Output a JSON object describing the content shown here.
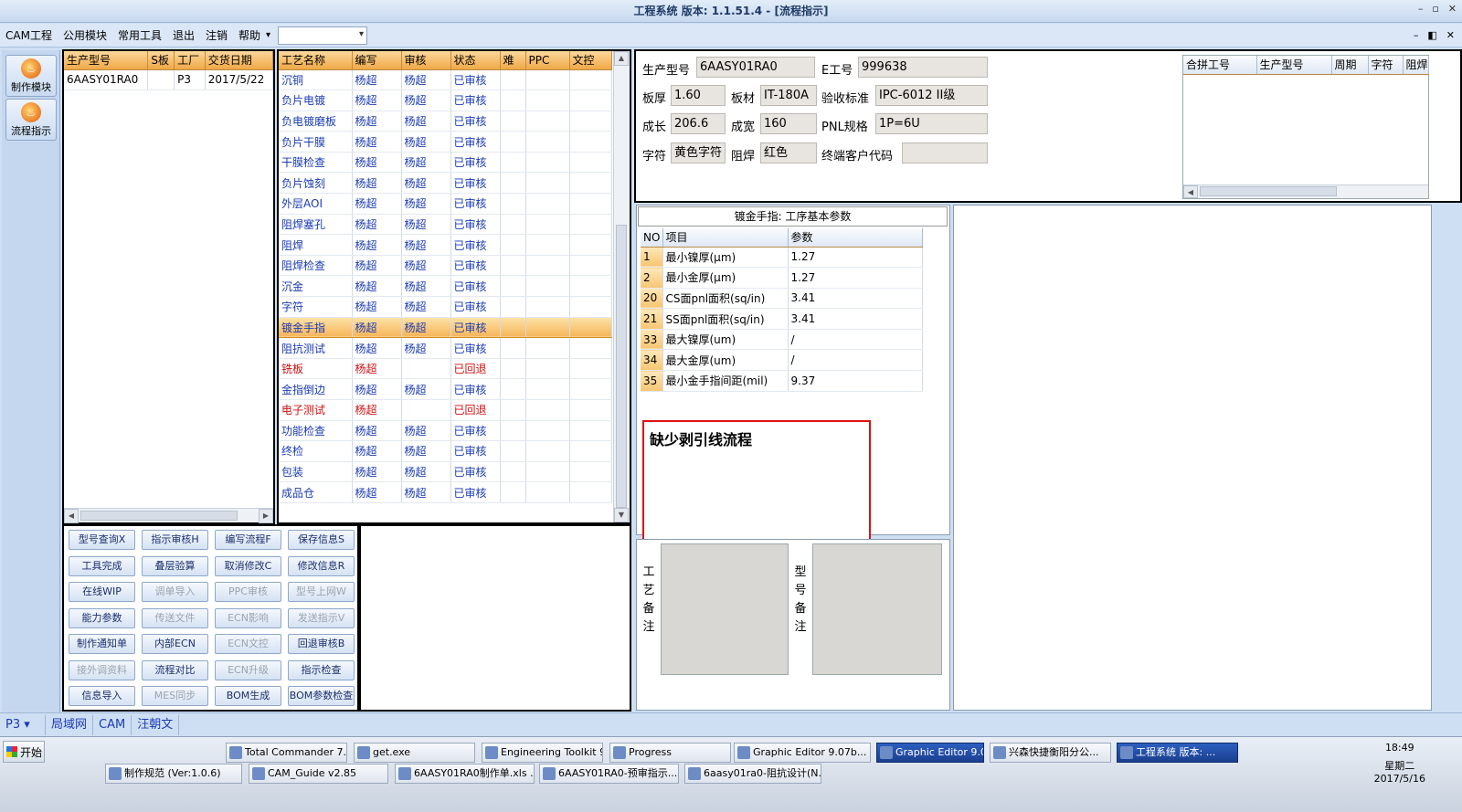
{
  "window": {
    "title": "工程系统 版本: 1.1.51.4 - [流程指示]",
    "win_min": "–",
    "win_max": "▫",
    "win_close": "✕"
  },
  "menu": {
    "items": [
      "CAM工程",
      "公用模块",
      "常用工具",
      "退出",
      "注销",
      "帮助"
    ],
    "help_arrow": "▾"
  },
  "mdi": {
    "min": "–",
    "restore": "◧",
    "close": "✕"
  },
  "nav": {
    "make_module": "制作模块",
    "flow_guide": "流程指示"
  },
  "orders": {
    "headers": [
      "生产型号",
      "S板",
      "工厂",
      "交货日期"
    ],
    "rows": [
      [
        "6AASY01RA0",
        "",
        "P3",
        "2017/5/22"
      ]
    ]
  },
  "process": {
    "headers": [
      "工艺名称",
      "编写",
      "审核",
      "状态",
      "难",
      "PPC",
      "文控"
    ],
    "rows": [
      {
        "name": "沉铜",
        "writer": "杨超",
        "reviewer": "杨超",
        "status": "已审核",
        "red": false
      },
      {
        "name": "负片电镀",
        "writer": "杨超",
        "reviewer": "杨超",
        "status": "已审核",
        "red": false
      },
      {
        "name": "负电镀磨板",
        "writer": "杨超",
        "reviewer": "杨超",
        "status": "已审核",
        "red": false
      },
      {
        "name": "负片干膜",
        "writer": "杨超",
        "reviewer": "杨超",
        "status": "已审核",
        "red": false
      },
      {
        "name": "干膜检查",
        "writer": "杨超",
        "reviewer": "杨超",
        "status": "已审核",
        "red": false
      },
      {
        "name": "负片蚀刻",
        "writer": "杨超",
        "reviewer": "杨超",
        "status": "已审核",
        "red": false
      },
      {
        "name": "外层AOI",
        "writer": "杨超",
        "reviewer": "杨超",
        "status": "已审核",
        "red": false
      },
      {
        "name": "阻焊塞孔",
        "writer": "杨超",
        "reviewer": "杨超",
        "status": "已审核",
        "red": false
      },
      {
        "name": "阻焊",
        "writer": "杨超",
        "reviewer": "杨超",
        "status": "已审核",
        "red": false
      },
      {
        "name": "阻焊检查",
        "writer": "杨超",
        "reviewer": "杨超",
        "status": "已审核",
        "red": false
      },
      {
        "name": "沉金",
        "writer": "杨超",
        "reviewer": "杨超",
        "status": "已审核",
        "red": false
      },
      {
        "name": "字符",
        "writer": "杨超",
        "reviewer": "杨超",
        "status": "已审核",
        "red": false
      },
      {
        "name": "镀金手指",
        "writer": "杨超",
        "reviewer": "杨超",
        "status": "已审核",
        "red": false,
        "selected": true
      },
      {
        "name": "阻抗测试",
        "writer": "杨超",
        "reviewer": "杨超",
        "status": "已审核",
        "red": false
      },
      {
        "name": "铣板",
        "writer": "杨超",
        "reviewer": "",
        "status": "已回退",
        "red": true
      },
      {
        "name": "金指倒边",
        "writer": "杨超",
        "reviewer": "杨超",
        "status": "已审核",
        "red": false
      },
      {
        "name": "电子测试",
        "writer": "杨超",
        "reviewer": "",
        "status": "已回退",
        "red": true
      },
      {
        "name": "功能检查",
        "writer": "杨超",
        "reviewer": "杨超",
        "status": "已审核",
        "red": false
      },
      {
        "name": "终检",
        "writer": "杨超",
        "reviewer": "杨超",
        "status": "已审核",
        "red": false
      },
      {
        "name": "包装",
        "writer": "杨超",
        "reviewer": "杨超",
        "status": "已审核",
        "red": false
      },
      {
        "name": "成品仓",
        "writer": "杨超",
        "reviewer": "杨超",
        "status": "已审核",
        "red": false
      }
    ]
  },
  "buttons": [
    {
      "label": "型号查询X",
      "disabled": false
    },
    {
      "label": "指示审核H",
      "disabled": false
    },
    {
      "label": "编写流程F",
      "disabled": false
    },
    {
      "label": "保存信息S",
      "disabled": false
    },
    {
      "label": "工具完成",
      "disabled": false
    },
    {
      "label": "叠层验算",
      "disabled": false
    },
    {
      "label": "取消修改C",
      "disabled": false
    },
    {
      "label": "修改信息R",
      "disabled": false
    },
    {
      "label": "在线WIP",
      "disabled": false
    },
    {
      "label": "调单导入",
      "disabled": true
    },
    {
      "label": "PPC审核",
      "disabled": true
    },
    {
      "label": "型号上网W",
      "disabled": true
    },
    {
      "label": "能力参数",
      "disabled": false
    },
    {
      "label": "传送文件",
      "disabled": true
    },
    {
      "label": "ECN影响",
      "disabled": true
    },
    {
      "label": "发送指示V",
      "disabled": true
    },
    {
      "label": "制作通知单",
      "disabled": false
    },
    {
      "label": "内部ECN",
      "disabled": false
    },
    {
      "label": "ECN文控",
      "disabled": true
    },
    {
      "label": "回退审核B",
      "disabled": false
    },
    {
      "label": "接外调资料",
      "disabled": true
    },
    {
      "label": "流程对比",
      "disabled": false
    },
    {
      "label": "ECN升级",
      "disabled": true
    },
    {
      "label": "指示检查",
      "disabled": false
    },
    {
      "label": "信息导入",
      "disabled": false
    },
    {
      "label": "MES同步",
      "disabled": true
    },
    {
      "label": "BOM生成",
      "disabled": false
    },
    {
      "label": "BOM参数检查",
      "disabled": false
    }
  ],
  "info": {
    "model_label": "生产型号",
    "model": "6AASY01RA0",
    "eno_label": "E工号",
    "eno": "999638",
    "thick_label": "板厚",
    "thick": "1.60",
    "mat_label": "板材",
    "mat": "IT-180A",
    "std_label": "验收标准",
    "std": "IPC-6012 II级",
    "len_label": "成长",
    "len": "206.6",
    "wid_label": "成宽",
    "wid": "160",
    "pnl_label": "PNL规格",
    "pnl": "1P=6U",
    "char_label": "字符",
    "char": "黄色字符",
    "mask_label": "阻焊",
    "mask": "红色",
    "cust_label": "终端客户代码",
    "cust": ""
  },
  "combine": {
    "headers": [
      "合拼工号",
      "生产型号",
      "周期",
      "字符",
      "阻焊"
    ]
  },
  "params": {
    "title": "镀金手指: 工序基本参数",
    "headers": [
      "NO",
      "项目",
      "参数"
    ],
    "rows": [
      [
        "1",
        "最小镍厚(μm)",
        "1.27"
      ],
      [
        "2",
        "最小金厚(μm)",
        "1.27"
      ],
      [
        "20",
        "CS面pnl面积(sq/in)",
        "3.41"
      ],
      [
        "21",
        "SS面pnl面积(sq/in)",
        "3.41"
      ],
      [
        "33",
        "最大镍厚(um)",
        "/"
      ],
      [
        "34",
        "最大金厚(um)",
        "/"
      ],
      [
        "35",
        "最小金手指间距(mil)",
        "9.37"
      ]
    ]
  },
  "note": "缺少剥引线流程",
  "remarks": {
    "process": "工艺备注",
    "model": "型号备注"
  },
  "status": {
    "plant": "P3",
    "arrow": "▾",
    "lan": "局域网",
    "cam": "CAM",
    "user": "汪朝文"
  },
  "taskbar": {
    "start": "开始",
    "row1": [
      "Total Commander 7....",
      "get.exe",
      "Engineering Toolkit 9...",
      "Progress",
      "Graphic Editor 9.07b...",
      "Graphic Editor 9.07b...",
      "兴森快捷衡阳分公...",
      "工程系统  版本: ..."
    ],
    "row2": [
      "制作规范 (Ver:1.0.6)",
      "CAM_Guide v2.85",
      "6AASY01RA0制作单.xls ...",
      "6AASY01RA0-预审指示....",
      "6aasy01ra0-阻抗设计(N..."
    ],
    "time": "18:49",
    "weekday": "星期二",
    "date": "2017/5/16"
  }
}
